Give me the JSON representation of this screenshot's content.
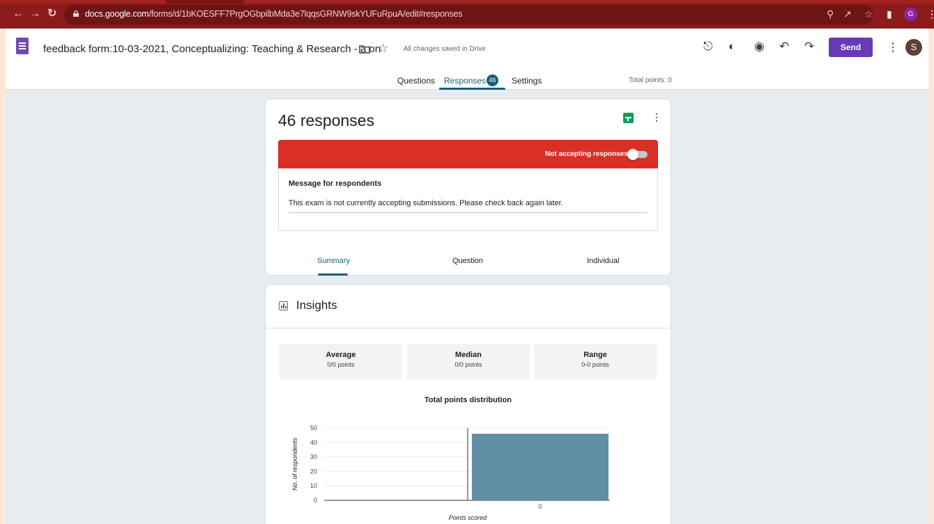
{
  "browser": {
    "url_host": "docs.google.com",
    "url_path": "/forms/d/1bKOESFF7PrgOGbpilbMda3e7lqqsGRNW9skYUFuRpuA/edit#responses",
    "profile_initial": "G"
  },
  "header": {
    "doc_title": "feedback form:10-03-2021, Conceptualizing: Teaching & Research - a on",
    "save_status": "All changes saved in Drive",
    "send_label": "Send",
    "avatar_initial": "S",
    "tabs": [
      {
        "label": "Questions"
      },
      {
        "label": "Responses",
        "badge": "46"
      },
      {
        "label": "Settings"
      }
    ],
    "total_points": "Total points: 0"
  },
  "responses_card": {
    "count_text": "46 responses",
    "banner_text": "Not accepting responses",
    "accepting": false,
    "message_label": "Message for respondents",
    "message_text": "This exam is not currently accepting submissions. Please check back again later.",
    "subtabs": [
      {
        "label": "Summary"
      },
      {
        "label": "Question"
      },
      {
        "label": "Individual"
      }
    ]
  },
  "insights": {
    "title": "Insights",
    "stats": [
      {
        "title": "Average",
        "value": "0/0 points"
      },
      {
        "title": "Median",
        "value": "0/0 points"
      },
      {
        "title": "Range",
        "value": "0-0 points"
      }
    ]
  },
  "chart_data": {
    "type": "bar",
    "title": "Total points distribution",
    "xlabel": "Points scored",
    "ylabel": "No. of respondents",
    "categories": [
      "0"
    ],
    "values": [
      46
    ],
    "ylim": [
      0,
      50
    ],
    "yticks": [
      "0",
      "10",
      "20",
      "30",
      "40",
      "50"
    ],
    "bar_color": "#5f8ea5",
    "grid": true
  },
  "colors": {
    "accent": "#1a5f7a",
    "brand_purple": "#673ab7",
    "banner_red": "#d93025"
  }
}
